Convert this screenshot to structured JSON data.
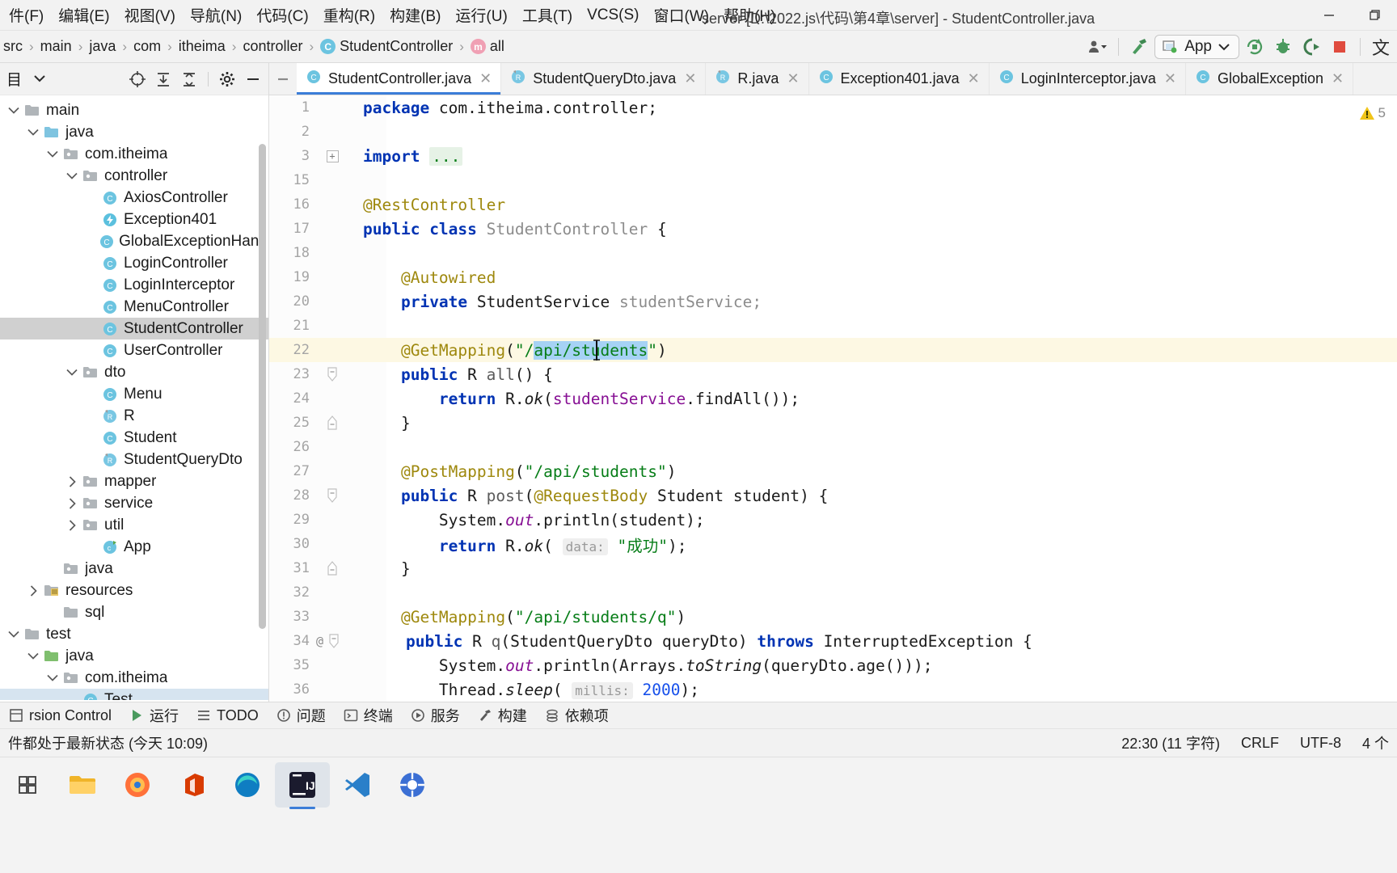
{
  "titlebar": {
    "menus": [
      {
        "label": "件(F)",
        "name": "menu-file"
      },
      {
        "label": "编辑(E)",
        "name": "menu-edit"
      },
      {
        "label": "视图(V)",
        "name": "menu-view"
      },
      {
        "label": "导航(N)",
        "name": "menu-navigate"
      },
      {
        "label": "代码(C)",
        "name": "menu-code"
      },
      {
        "label": "重构(R)",
        "name": "menu-refactor"
      },
      {
        "label": "构建(B)",
        "name": "menu-build"
      },
      {
        "label": "运行(U)",
        "name": "menu-run"
      },
      {
        "label": "工具(T)",
        "name": "menu-tools"
      },
      {
        "label": "VCS(S)",
        "name": "menu-vcs"
      },
      {
        "label": "窗口(W)",
        "name": "menu-window"
      },
      {
        "label": "帮助(H)",
        "name": "menu-help"
      }
    ],
    "window_title": "server [D:\\2022.js\\代码\\第4章\\server] - StudentController.java"
  },
  "breadcrumb": {
    "items": [
      {
        "label": "src",
        "icon": ""
      },
      {
        "label": "main",
        "icon": ""
      },
      {
        "label": "java",
        "icon": ""
      },
      {
        "label": "com",
        "icon": ""
      },
      {
        "label": "itheima",
        "icon": ""
      },
      {
        "label": "controller",
        "icon": ""
      },
      {
        "label": "StudentController",
        "icon": "C"
      },
      {
        "label": "all",
        "icon": "m"
      }
    ]
  },
  "toolbar": {
    "run_config_label": "App",
    "icons": [
      "user-dropdown-icon",
      "hammer-icon",
      "run-config-dropdown",
      "rerun-icon",
      "debug-icon",
      "coverage-icon",
      "stop-icon",
      "chinese-icon"
    ]
  },
  "sidebar": {
    "title": "目",
    "tools": [
      "locate-icon",
      "expand-all-icon",
      "collapse-all-icon",
      "settings-icon",
      "hide-icon"
    ],
    "tree": [
      {
        "label": "main",
        "indent": 0,
        "arrow": "down",
        "icon": "folder",
        "selected": false
      },
      {
        "label": "java",
        "indent": 1,
        "arrow": "down",
        "icon": "folder-source",
        "selected": false
      },
      {
        "label": "com.itheima",
        "indent": 2,
        "arrow": "down",
        "icon": "folder-pkg",
        "selected": false
      },
      {
        "label": "controller",
        "indent": 3,
        "arrow": "down",
        "icon": "folder-pkg",
        "selected": false
      },
      {
        "label": "AxiosController",
        "indent": 4,
        "arrow": "none",
        "icon": "class",
        "selected": false
      },
      {
        "label": "Exception401",
        "indent": 4,
        "arrow": "none",
        "icon": "exception",
        "selected": false
      },
      {
        "label": "GlobalExceptionHandler",
        "indent": 4,
        "arrow": "none",
        "icon": "class",
        "selected": false
      },
      {
        "label": "LoginController",
        "indent": 4,
        "arrow": "none",
        "icon": "class",
        "selected": false
      },
      {
        "label": "LoginInterceptor",
        "indent": 4,
        "arrow": "none",
        "icon": "class",
        "selected": false
      },
      {
        "label": "MenuController",
        "indent": 4,
        "arrow": "none",
        "icon": "class",
        "selected": false
      },
      {
        "label": "StudentController",
        "indent": 4,
        "arrow": "none",
        "icon": "class",
        "selected": true
      },
      {
        "label": "UserController",
        "indent": 4,
        "arrow": "none",
        "icon": "class",
        "selected": false
      },
      {
        "label": "dto",
        "indent": 3,
        "arrow": "down",
        "icon": "folder-pkg",
        "selected": false
      },
      {
        "label": "Menu",
        "indent": 4,
        "arrow": "none",
        "icon": "class",
        "selected": false
      },
      {
        "label": "R",
        "indent": 4,
        "arrow": "none",
        "icon": "record",
        "selected": false
      },
      {
        "label": "Student",
        "indent": 4,
        "arrow": "none",
        "icon": "class",
        "selected": false
      },
      {
        "label": "StudentQueryDto",
        "indent": 4,
        "arrow": "none",
        "icon": "record",
        "selected": false
      },
      {
        "label": "mapper",
        "indent": 3,
        "arrow": "right",
        "icon": "folder-pkg",
        "selected": false
      },
      {
        "label": "service",
        "indent": 3,
        "arrow": "right",
        "icon": "folder-pkg",
        "selected": false
      },
      {
        "label": "util",
        "indent": 3,
        "arrow": "right",
        "icon": "folder-pkg",
        "selected": false
      },
      {
        "label": "App",
        "indent": 4,
        "arrow": "none",
        "icon": "springboot",
        "selected": false
      },
      {
        "label": "java",
        "indent": 2,
        "arrow": "none",
        "icon": "folder-pkg",
        "selected": false
      },
      {
        "label": "resources",
        "indent": 1,
        "arrow": "right",
        "icon": "folder-res",
        "selected": false
      },
      {
        "label": "sql",
        "indent": 2,
        "arrow": "none",
        "icon": "folder",
        "selected": false
      },
      {
        "label": "test",
        "indent": 0,
        "arrow": "down",
        "icon": "folder",
        "selected": false
      },
      {
        "label": "java",
        "indent": 1,
        "arrow": "down",
        "icon": "folder-test",
        "selected": false
      },
      {
        "label": "com.itheima",
        "indent": 2,
        "arrow": "down",
        "icon": "folder-pkg",
        "selected": false
      },
      {
        "label": "Test",
        "indent": 3,
        "arrow": "none",
        "icon": "class",
        "selected": false,
        "highlight": true
      }
    ]
  },
  "tabs": [
    {
      "label": "StudentController.java",
      "icon": "C",
      "active": true
    },
    {
      "label": "StudentQueryDto.java",
      "icon": "R",
      "active": false
    },
    {
      "label": "R.java",
      "icon": "R",
      "active": false
    },
    {
      "label": "Exception401.java",
      "icon": "C",
      "active": false
    },
    {
      "label": "LoginInterceptor.java",
      "icon": "C",
      "active": false
    },
    {
      "label": "GlobalException",
      "icon": "C",
      "active": false
    }
  ],
  "editor": {
    "warning_count": "5",
    "lines": [
      {
        "num": "1",
        "gmark": "",
        "highlight": false,
        "tokens": [
          {
            "t": "package ",
            "c": "kw"
          },
          {
            "t": "com.itheima.controller;",
            "c": "ident"
          }
        ]
      },
      {
        "num": "2",
        "gmark": "",
        "highlight": false,
        "tokens": []
      },
      {
        "num": "3",
        "gmark": "+",
        "highlight": false,
        "tokens": [
          {
            "t": "import ",
            "c": "kw"
          },
          {
            "t": "...",
            "c": "fold-import"
          }
        ]
      },
      {
        "num": "15",
        "gmark": "",
        "highlight": false,
        "tokens": []
      },
      {
        "num": "16",
        "gmark": "",
        "highlight": false,
        "tokens": [
          {
            "t": "@RestController",
            "c": "ann"
          }
        ]
      },
      {
        "num": "17",
        "gmark": "",
        "highlight": false,
        "tokens": [
          {
            "t": "public ",
            "c": "kw"
          },
          {
            "t": "class ",
            "c": "kw"
          },
          {
            "t": "StudentController",
            "c": "gray"
          },
          {
            "t": " {",
            "c": "ident"
          }
        ]
      },
      {
        "num": "18",
        "gmark": "",
        "highlight": false,
        "tokens": []
      },
      {
        "num": "19",
        "gmark": "",
        "highlight": false,
        "tokens": [
          {
            "t": "    @Autowired",
            "c": "ann"
          }
        ]
      },
      {
        "num": "20",
        "gmark": "",
        "highlight": false,
        "tokens": [
          {
            "t": "    ",
            "c": "ident"
          },
          {
            "t": "private ",
            "c": "kw"
          },
          {
            "t": "StudentService ",
            "c": "ident"
          },
          {
            "t": "studentService;",
            "c": "gray"
          }
        ]
      },
      {
        "num": "21",
        "gmark": "",
        "highlight": false,
        "tokens": []
      },
      {
        "num": "22",
        "gmark": "",
        "highlight": true,
        "tokens": [
          {
            "t": "    ",
            "c": "ident"
          },
          {
            "t": "@GetMapping",
            "c": "ann"
          },
          {
            "t": "(",
            "c": "ident"
          },
          {
            "t": "\"/",
            "c": "str"
          },
          {
            "t": "api/students",
            "c": "sel-str"
          },
          {
            "t": "\"",
            "c": "str"
          },
          {
            "t": ")",
            "c": "ident"
          }
        ]
      },
      {
        "num": "23",
        "gmark": "-",
        "highlight": false,
        "tokens": [
          {
            "t": "    ",
            "c": "ident"
          },
          {
            "t": "public ",
            "c": "kw"
          },
          {
            "t": "R ",
            "c": "ident"
          },
          {
            "t": "all",
            "c": "mth"
          },
          {
            "t": "() {",
            "c": "ident"
          }
        ]
      },
      {
        "num": "24",
        "gmark": "",
        "highlight": false,
        "tokens": [
          {
            "t": "        ",
            "c": "ident"
          },
          {
            "t": "return ",
            "c": "kw"
          },
          {
            "t": "R.",
            "c": "ident"
          },
          {
            "t": "ok",
            "c": "mth-italic"
          },
          {
            "t": "(",
            "c": "ident"
          },
          {
            "t": "studentService",
            "c": "fld"
          },
          {
            "t": ".findAll());",
            "c": "ident"
          }
        ]
      },
      {
        "num": "25",
        "gmark": "=",
        "highlight": false,
        "tokens": [
          {
            "t": "    }",
            "c": "ident"
          }
        ]
      },
      {
        "num": "26",
        "gmark": "",
        "highlight": false,
        "tokens": []
      },
      {
        "num": "27",
        "gmark": "",
        "highlight": false,
        "tokens": [
          {
            "t": "    ",
            "c": "ident"
          },
          {
            "t": "@PostMapping",
            "c": "ann"
          },
          {
            "t": "(",
            "c": "ident"
          },
          {
            "t": "\"/api/students\"",
            "c": "str"
          },
          {
            "t": ")",
            "c": "ident"
          }
        ]
      },
      {
        "num": "28",
        "gmark": "-",
        "highlight": false,
        "tokens": [
          {
            "t": "    ",
            "c": "ident"
          },
          {
            "t": "public ",
            "c": "kw"
          },
          {
            "t": "R ",
            "c": "ident"
          },
          {
            "t": "post",
            "c": "mth"
          },
          {
            "t": "(",
            "c": "ident"
          },
          {
            "t": "@RequestBody",
            "c": "ann"
          },
          {
            "t": " Student student) {",
            "c": "ident"
          }
        ]
      },
      {
        "num": "29",
        "gmark": "",
        "highlight": false,
        "tokens": [
          {
            "t": "        System.",
            "c": "ident"
          },
          {
            "t": "out",
            "c": "fld-italic"
          },
          {
            "t": ".println(student);",
            "c": "ident"
          }
        ]
      },
      {
        "num": "30",
        "gmark": "",
        "highlight": false,
        "tokens": [
          {
            "t": "        ",
            "c": "ident"
          },
          {
            "t": "return ",
            "c": "kw"
          },
          {
            "t": "R.",
            "c": "ident"
          },
          {
            "t": "ok",
            "c": "mth-italic"
          },
          {
            "t": "( ",
            "c": "ident"
          },
          {
            "t": "data:",
            "c": "hint"
          },
          {
            "t": " ",
            "c": "ident"
          },
          {
            "t": "\"成功\"",
            "c": "str"
          },
          {
            "t": ");",
            "c": "ident"
          }
        ]
      },
      {
        "num": "31",
        "gmark": "=",
        "highlight": false,
        "tokens": [
          {
            "t": "    }",
            "c": "ident"
          }
        ]
      },
      {
        "num": "32",
        "gmark": "",
        "highlight": false,
        "tokens": []
      },
      {
        "num": "33",
        "gmark": "",
        "highlight": false,
        "tokens": [
          {
            "t": "    ",
            "c": "ident"
          },
          {
            "t": "@GetMapping",
            "c": "ann"
          },
          {
            "t": "(",
            "c": "ident"
          },
          {
            "t": "\"/api/students/q\"",
            "c": "str"
          },
          {
            "t": ")",
            "c": "ident"
          }
        ]
      },
      {
        "num": "34",
        "gmark": "@-",
        "highlight": false,
        "tokens": [
          {
            "t": "    ",
            "c": "ident"
          },
          {
            "t": "public ",
            "c": "kw"
          },
          {
            "t": "R ",
            "c": "ident"
          },
          {
            "t": "q",
            "c": "mth"
          },
          {
            "t": "(StudentQueryDto queryDto) ",
            "c": "ident"
          },
          {
            "t": "throws ",
            "c": "kw"
          },
          {
            "t": "InterruptedException {",
            "c": "ident"
          }
        ]
      },
      {
        "num": "35",
        "gmark": "",
        "highlight": false,
        "tokens": [
          {
            "t": "        System.",
            "c": "ident"
          },
          {
            "t": "out",
            "c": "fld-italic"
          },
          {
            "t": ".println(Arrays.",
            "c": "ident"
          },
          {
            "t": "toString",
            "c": "mth-italic"
          },
          {
            "t": "(queryDto.age()));",
            "c": "ident"
          }
        ]
      },
      {
        "num": "36",
        "gmark": "",
        "highlight": false,
        "tokens": [
          {
            "t": "        Thread.",
            "c": "ident"
          },
          {
            "t": "sleep",
            "c": "mth-italic"
          },
          {
            "t": "( ",
            "c": "ident"
          },
          {
            "t": "millis:",
            "c": "hint"
          },
          {
            "t": " ",
            "c": "ident"
          },
          {
            "t": "2000",
            "c": "num"
          },
          {
            "t": ");",
            "c": "ident"
          }
        ]
      }
    ]
  },
  "bottombar": {
    "items": [
      {
        "label": "rsion Control",
        "icon": "vcs-icon"
      },
      {
        "label": "运行",
        "icon": "run-icon"
      },
      {
        "label": "TODO",
        "icon": "todo-icon"
      },
      {
        "label": "问题",
        "icon": "problems-icon"
      },
      {
        "label": "终端",
        "icon": "terminal-icon"
      },
      {
        "label": "服务",
        "icon": "services-icon"
      },
      {
        "label": "构建",
        "icon": "build-icon"
      },
      {
        "label": "依赖项",
        "icon": "dependencies-icon"
      }
    ]
  },
  "statusbar": {
    "left": "件都处于最新状态 (今天 10:09)",
    "position": "22:30 (11 字符)",
    "line_sep": "CRLF",
    "encoding": "UTF-8",
    "indent": "4 个"
  },
  "taskbar": {
    "items": [
      {
        "name": "start-button",
        "glyph": "⊟",
        "color": "#3c3c3c",
        "bg": "transparent",
        "active": false
      },
      {
        "name": "file-explorer",
        "glyph": "",
        "color": "#fff",
        "bg": "#f0b429",
        "active": false
      },
      {
        "name": "firefox",
        "glyph": "",
        "color": "#fff",
        "bg": "#e8632a",
        "active": false
      },
      {
        "name": "office",
        "glyph": "O",
        "color": "#fff",
        "bg": "#d83b01",
        "active": false
      },
      {
        "name": "edge",
        "glyph": "",
        "color": "#fff",
        "bg": "#0f7dc2",
        "active": false
      },
      {
        "name": "intellij-idea",
        "glyph": "IJ",
        "color": "#fff",
        "bg": "#1b1b2e",
        "active": true
      },
      {
        "name": "vscode",
        "glyph": "",
        "color": "#fff",
        "bg": "#2a7fc9",
        "active": false
      },
      {
        "name": "app-blue",
        "glyph": "",
        "color": "#fff",
        "bg": "#3b6fd4",
        "active": false
      }
    ]
  },
  "colors": {
    "accent": "#3b7dd8",
    "selection": "#a6d2f5",
    "current_line": "#fdf8e3",
    "tree_selection": "#d0d0d0",
    "keyword": "#0033b3",
    "string": "#067d17",
    "annotation": "#9e880d",
    "field": "#871094",
    "number": "#1750eb"
  }
}
